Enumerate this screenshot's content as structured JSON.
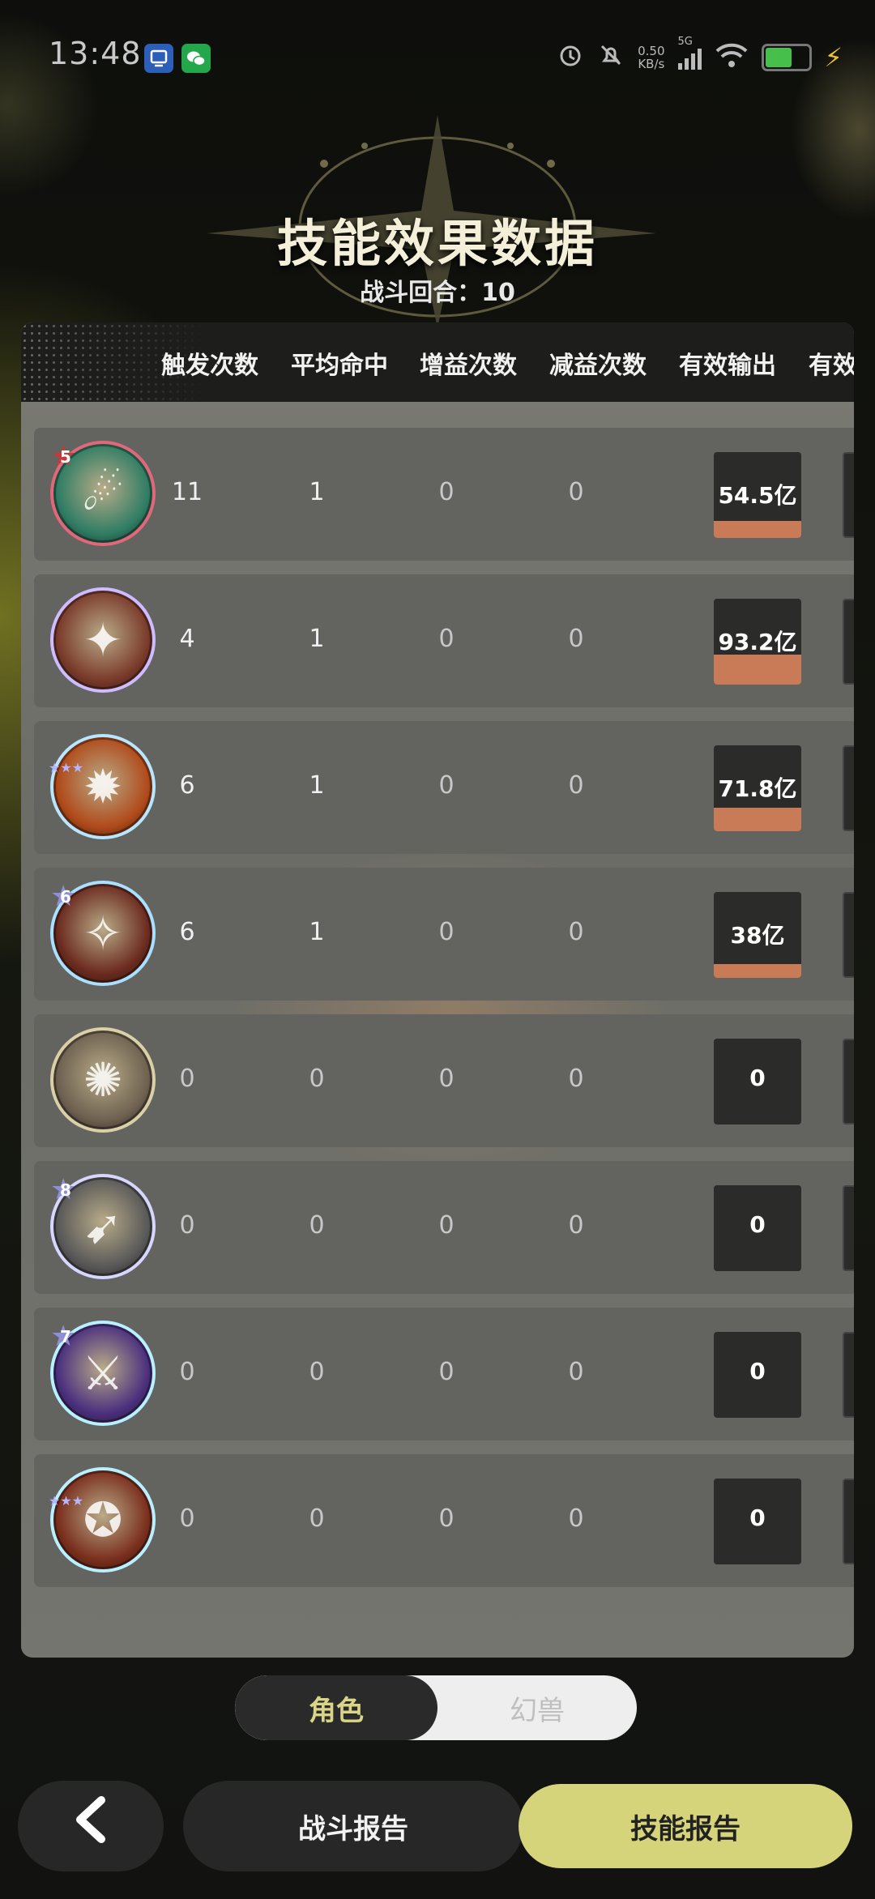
{
  "status_bar": {
    "time": "13:48",
    "network_speed": "0.50",
    "network_unit": "KB/s",
    "network_type": "5G",
    "battery_color": "#46c04a",
    "icons": [
      "app-notification-icon",
      "wechat-icon",
      "alarm-icon",
      "mute-icon",
      "signal-icon",
      "wifi-icon",
      "battery-icon",
      "charging-icon"
    ]
  },
  "header": {
    "title": "技能效果数据",
    "round_label": "战斗回合：",
    "round_value": "10"
  },
  "table": {
    "columns": [
      "触发次数",
      "平均命中",
      "增益次数",
      "减益次数",
      "有效输出",
      "有效"
    ],
    "rows": [
      {
        "icon": "comet-skill-icon",
        "badge": "5",
        "stars": "",
        "frame": "#e0687a",
        "fill": "#2f7d64",
        "glyph": "☄",
        "triggers": "11",
        "avg_hit": "1",
        "buffs": "0",
        "debuffs": "0",
        "output": "54.5亿",
        "output_level": 0.2
      },
      {
        "icon": "spark-skill-icon",
        "badge": "",
        "stars": "",
        "frame": "#cdbcff",
        "fill": "#7a3a2a",
        "glyph": "✦",
        "triggers": "4",
        "avg_hit": "1",
        "buffs": "0",
        "debuffs": "0",
        "output": "93.2亿",
        "output_level": 0.35
      },
      {
        "icon": "explosion-skill-icon",
        "badge": "",
        "stars": "★★★",
        "frame": "#b8e6ff",
        "fill": "#b04a1a",
        "glyph": "✹",
        "triggers": "6",
        "avg_hit": "1",
        "buffs": "0",
        "debuffs": "0",
        "output": "71.8亿",
        "output_level": 0.27
      },
      {
        "icon": "flame-claw-skill-icon",
        "badge": "6",
        "stars": "",
        "frame": "#a9e0ff",
        "fill": "#6b2a1e",
        "glyph": "✧",
        "triggers": "6",
        "avg_hit": "1",
        "buffs": "0",
        "debuffs": "0",
        "output": "38亿",
        "output_level": 0.16
      },
      {
        "icon": "vortex-skill-icon",
        "badge": "",
        "stars": "",
        "frame": "#d9d0a8",
        "fill": "#6e6150",
        "glyph": "✺",
        "triggers": "0",
        "avg_hit": "0",
        "buffs": "0",
        "debuffs": "0",
        "output": "0",
        "output_level": 0
      },
      {
        "icon": "dash-skill-icon",
        "badge": "8",
        "stars": "",
        "frame": "#d6d6ff",
        "fill": "#585858",
        "glyph": "➹",
        "triggers": "0",
        "avg_hit": "0",
        "buffs": "0",
        "debuffs": "0",
        "output": "0",
        "output_level": 0
      },
      {
        "icon": "sword-skill-icon",
        "badge": "7",
        "stars": "",
        "frame": "#b8f0ff",
        "fill": "#4a2f7e",
        "glyph": "⚔",
        "triggers": "0",
        "avg_hit": "0",
        "buffs": "0",
        "debuffs": "0",
        "output": "0",
        "output_level": 0
      },
      {
        "icon": "fire-spirit-skill-icon",
        "badge": "",
        "stars": "★★★",
        "frame": "#b8f0ff",
        "fill": "#7a2e1c",
        "glyph": "✪",
        "triggers": "0",
        "avg_hit": "0",
        "buffs": "0",
        "debuffs": "0",
        "output": "0",
        "output_level": 0
      }
    ]
  },
  "toggle": {
    "active": "角色",
    "inactive": "幻兽"
  },
  "footer": {
    "back_icon": "back-arrow-icon",
    "battle_report": "战斗报告",
    "skill_report": "技能报告"
  },
  "colors": {
    "accent": "#d6d47a",
    "output_bar": "#c97a57"
  }
}
